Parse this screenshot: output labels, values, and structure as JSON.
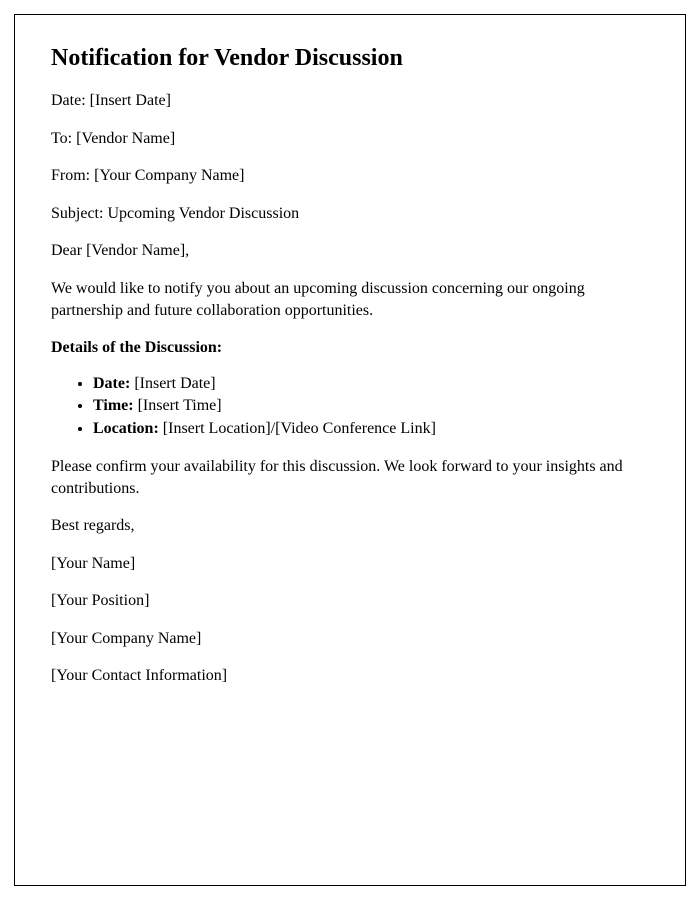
{
  "title": "Notification for Vendor Discussion",
  "header": {
    "date_label": "Date: ",
    "date_value": "[Insert Date]",
    "to_label": "To: ",
    "to_value": "[Vendor Name]",
    "from_label": "From: ",
    "from_value": "[Your Company Name]",
    "subject_label": "Subject: ",
    "subject_value": "Upcoming Vendor Discussion"
  },
  "salutation": "Dear [Vendor Name],",
  "intro": "We would like to notify you about an upcoming discussion concerning our ongoing partnership and future collaboration opportunities.",
  "details_heading": "Details of the Discussion:",
  "details": {
    "date_label": "Date:",
    "date_value": " [Insert Date]",
    "time_label": "Time:",
    "time_value": " [Insert Time]",
    "location_label": "Location:",
    "location_value": " [Insert Location]/[Video Conference Link]"
  },
  "closing_request": "Please confirm your availability for this discussion. We look forward to your insights and contributions.",
  "signoff": "Best regards,",
  "signature": {
    "name": "[Your Name]",
    "position": "[Your Position]",
    "company": "[Your Company Name]",
    "contact": "[Your Contact Information]"
  }
}
